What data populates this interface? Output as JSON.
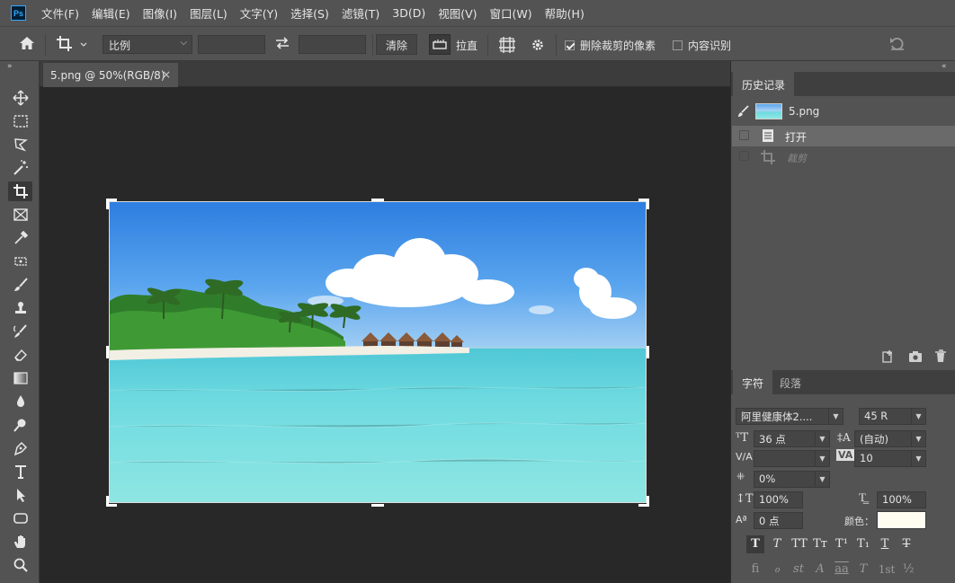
{
  "app": {
    "logo": "Ps"
  },
  "menu": [
    "文件(F)",
    "编辑(E)",
    "图像(I)",
    "图层(L)",
    "文字(Y)",
    "选择(S)",
    "滤镜(T)",
    "3D(D)",
    "视图(V)",
    "窗口(W)",
    "帮助(H)"
  ],
  "options": {
    "ratio_select": "比例",
    "ratio_width": "",
    "ratio_height": "",
    "clear_label": "清除",
    "straighten_label": "拉直",
    "delete_cropped_label": "删除裁剪的像素",
    "delete_cropped_checked": true,
    "content_aware_label": "内容识别",
    "content_aware_checked": false
  },
  "document": {
    "tab_title": "5.png @ 50%(RGB/8)",
    "close": "×"
  },
  "history": {
    "tab_label": "历史记录",
    "snapshot_name": "5.png",
    "steps": [
      {
        "label": "打开",
        "selected": true,
        "icon": "document-icon"
      },
      {
        "label": "裁剪",
        "selected": false,
        "icon": "crop-icon"
      }
    ]
  },
  "character": {
    "tab_label": "字符",
    "tab2_label": "段落",
    "font_family": "阿里健康体2....",
    "font_style": "45 R",
    "font_size": "36 点",
    "leading": "(自动)",
    "kerning": "",
    "tracking": "10",
    "tsume": "0%",
    "vertical_scale": "100%",
    "horizontal_scale": "100%",
    "baseline_shift": "0 点",
    "color_label": "颜色：",
    "color_value": "#fffdf0",
    "style_buttons": [
      "T",
      "T",
      "TT",
      "Tт",
      "T¹",
      "T₁",
      "T",
      "T"
    ],
    "opentype_buttons": [
      "fi",
      "ℴ",
      "st",
      "A",
      "aa",
      "T",
      "1st",
      "½"
    ]
  },
  "colors": {
    "accent": "#31a8ff",
    "ui_dark": "#535353",
    "canvas_bg": "#282828"
  }
}
